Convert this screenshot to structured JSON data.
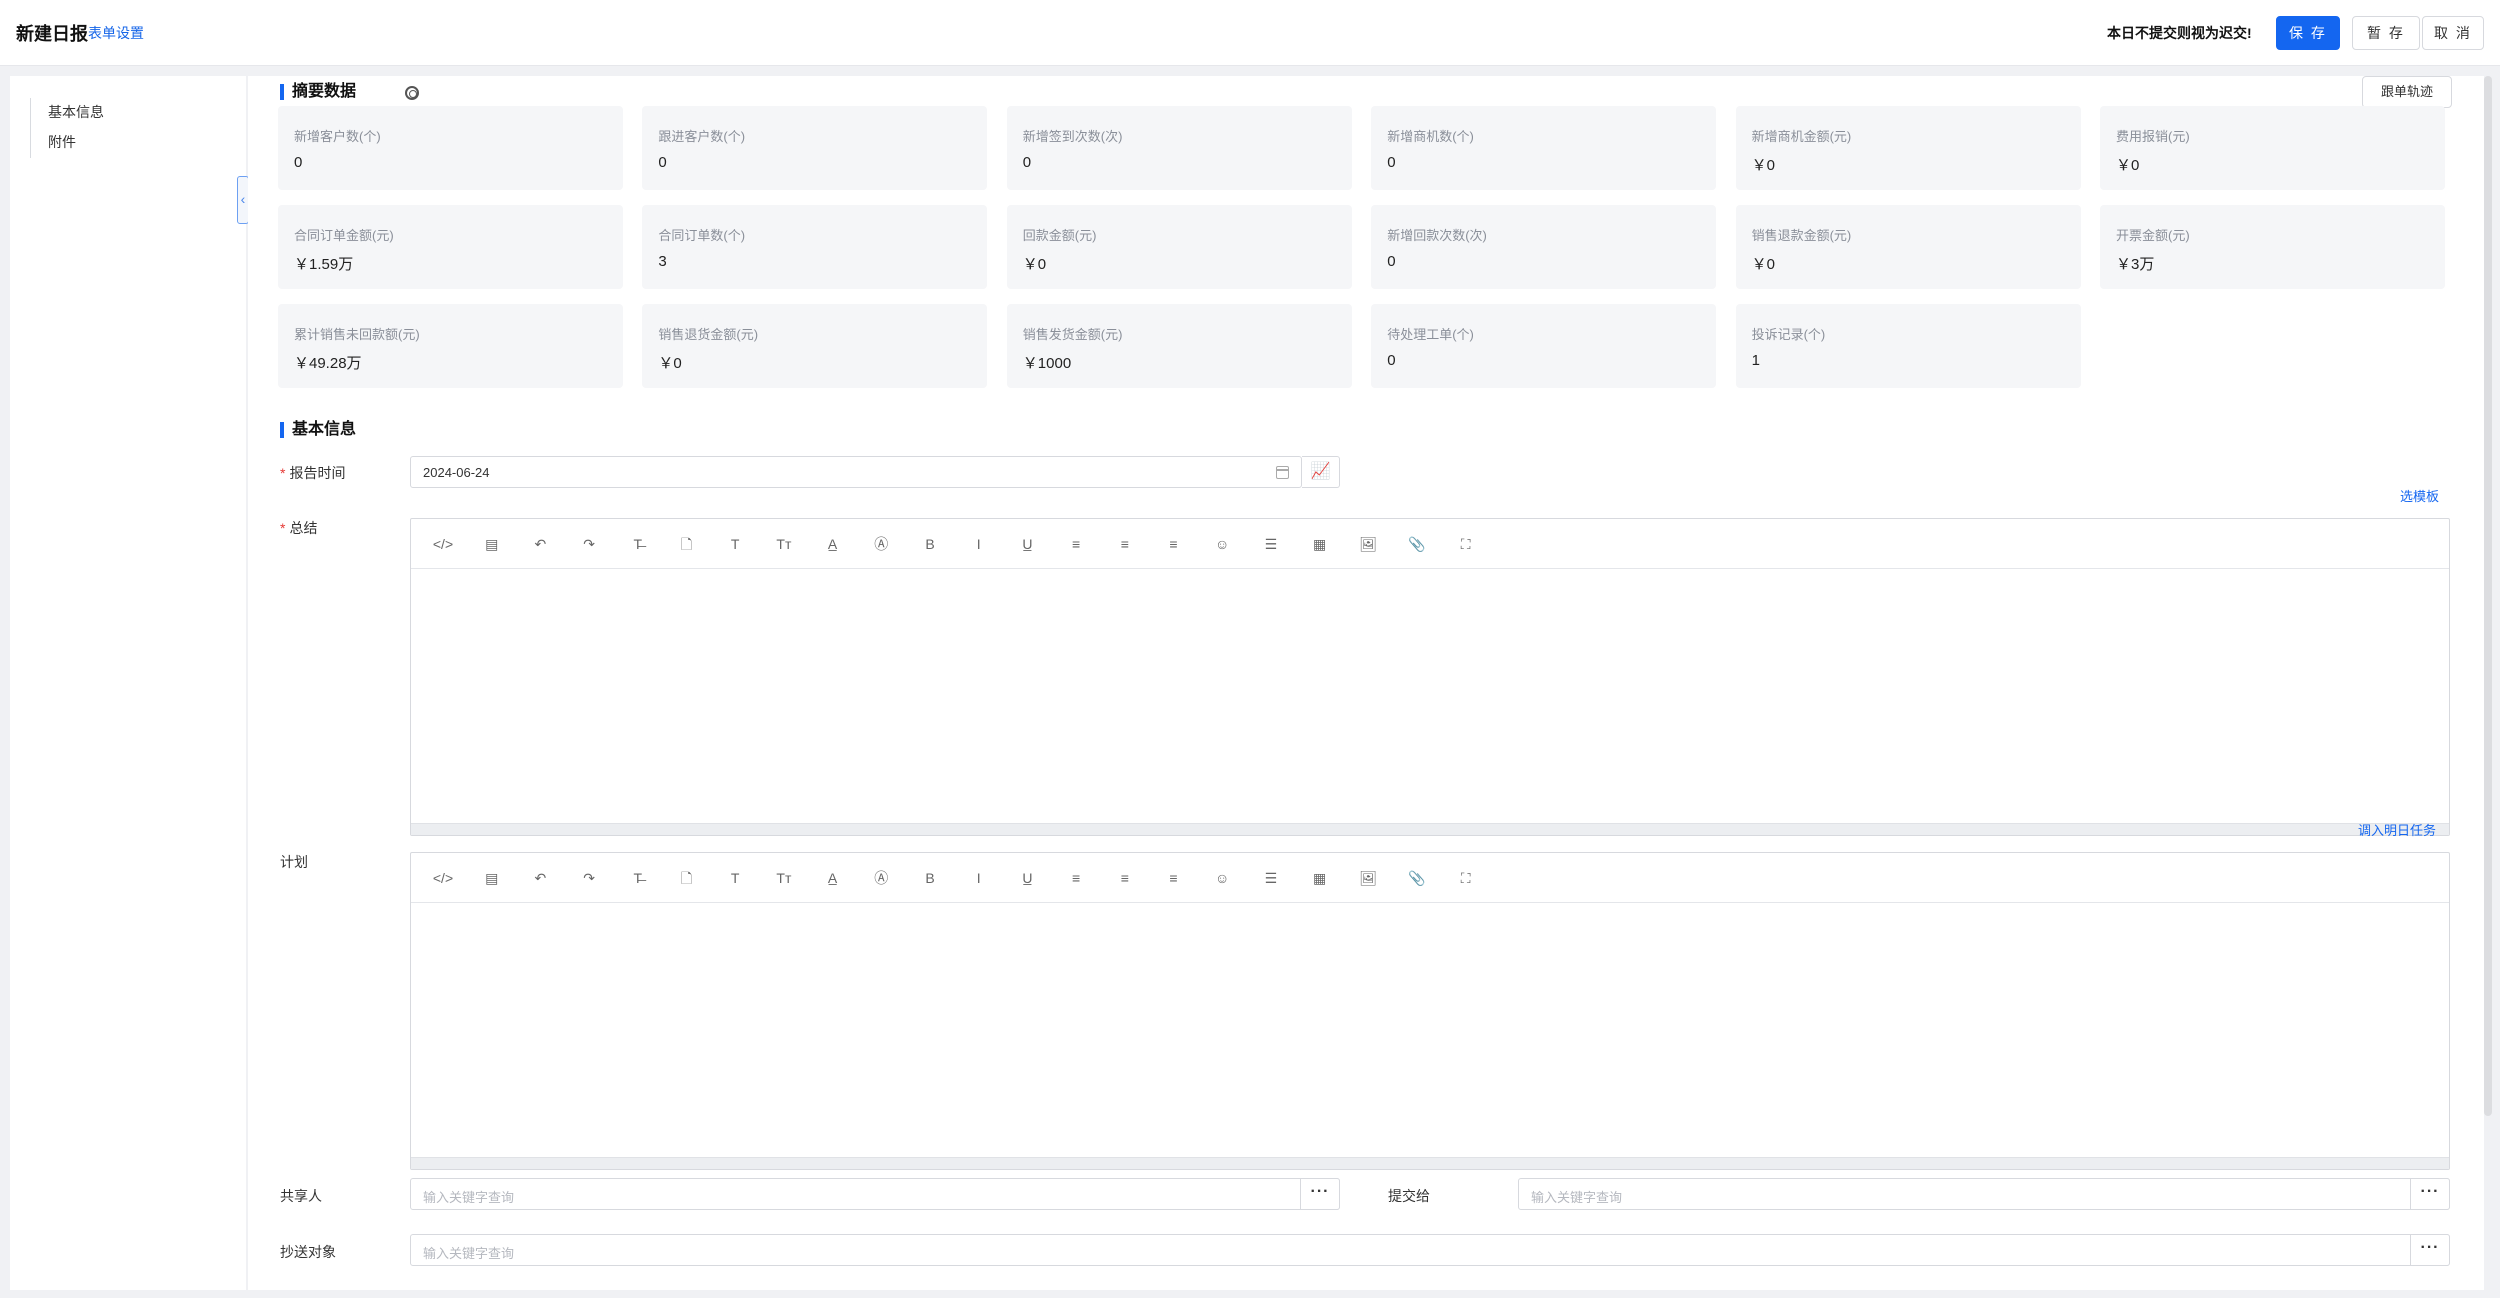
{
  "header": {
    "title": "新建日报",
    "form_settings": "表单设置",
    "late_notice": "本日不提交则视为迟交!",
    "save": "保 存",
    "draft": "暂 存",
    "cancel": "取 消"
  },
  "sidebar": {
    "items": [
      {
        "label": "基本信息"
      },
      {
        "label": "附件"
      }
    ]
  },
  "summary": {
    "title": "摘要数据",
    "track_button": "跟单轨迹",
    "cards": [
      {
        "label": "新增客户数(个)",
        "value": "0"
      },
      {
        "label": "跟进客户数(个)",
        "value": "0"
      },
      {
        "label": "新增签到次数(次)",
        "value": "0"
      },
      {
        "label": "新增商机数(个)",
        "value": "0"
      },
      {
        "label": "新增商机金额(元)",
        "value": "￥0"
      },
      {
        "label": "费用报销(元)",
        "value": "￥0"
      },
      {
        "label": "合同订单金额(元)",
        "value": "￥1.59万"
      },
      {
        "label": "合同订单数(个)",
        "value": "3"
      },
      {
        "label": "回款金额(元)",
        "value": "￥0"
      },
      {
        "label": "新增回款次数(次)",
        "value": "0"
      },
      {
        "label": "销售退款金额(元)",
        "value": "￥0"
      },
      {
        "label": "开票金额(元)",
        "value": "￥3万"
      },
      {
        "label": "累计销售未回款额(元)",
        "value": "￥49.28万"
      },
      {
        "label": "销售退货金额(元)",
        "value": "￥0"
      },
      {
        "label": "销售发货金额(元)",
        "value": "￥1000"
      },
      {
        "label": "待处理工单(个)",
        "value": "0"
      },
      {
        "label": "投诉记录(个)",
        "value": "1"
      }
    ]
  },
  "basic": {
    "title": "基本信息",
    "report_time_label": "报告时间",
    "report_time_value": "2024-06-24",
    "choose_template": "选模板",
    "summary_label": "总结",
    "import_tomorrow": "调入明日任务",
    "plan_label": "计划",
    "sharer_label": "共享人",
    "submit_to_label": "提交给",
    "cc_label": "抄送对象",
    "search_placeholder": "输入关键字查询"
  },
  "toolbar_icons": [
    {
      "name": "code-icon",
      "glyph": "</>"
    },
    {
      "name": "format-icon",
      "glyph": "▤"
    },
    {
      "name": "undo-icon",
      "glyph": "↶"
    },
    {
      "name": "redo-icon",
      "glyph": "↷"
    },
    {
      "name": "strikethrough-icon",
      "glyph": "T̶"
    },
    {
      "name": "clear-format-icon",
      "glyph": "🗋"
    },
    {
      "name": "font-icon",
      "glyph": "T"
    },
    {
      "name": "font-size-icon",
      "glyph": "Tт"
    },
    {
      "name": "font-color-icon",
      "glyph": "A̲"
    },
    {
      "name": "background-color-icon",
      "glyph": "Ⓐ"
    },
    {
      "name": "bold-icon",
      "glyph": "B"
    },
    {
      "name": "italic-icon",
      "glyph": "I"
    },
    {
      "name": "underline-icon",
      "glyph": "U̲"
    },
    {
      "name": "align-left-icon",
      "glyph": "≡"
    },
    {
      "name": "align-center-icon",
      "glyph": "≡"
    },
    {
      "name": "align-right-icon",
      "glyph": "≡"
    },
    {
      "name": "emoji-icon",
      "glyph": "☺"
    },
    {
      "name": "horizontal-rule-icon",
      "glyph": "☰"
    },
    {
      "name": "table-icon",
      "glyph": "▦"
    },
    {
      "name": "image-icon",
      "glyph": "🖼"
    },
    {
      "name": "attachment-icon",
      "glyph": "📎"
    },
    {
      "name": "fullscreen-icon",
      "glyph": "⛶"
    }
  ],
  "colors": {
    "accent": "#1466f0",
    "required": "#e53935"
  }
}
